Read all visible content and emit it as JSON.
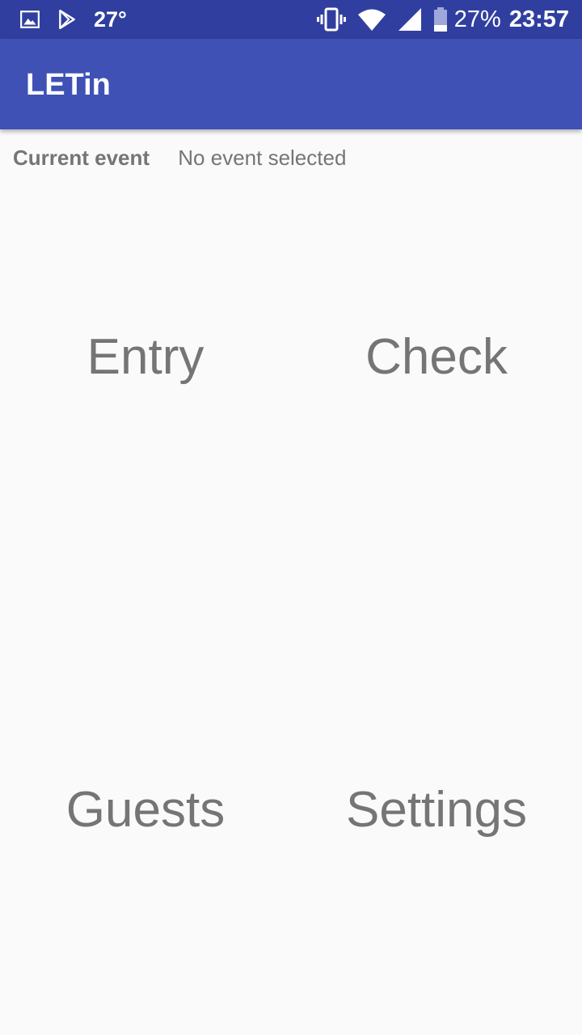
{
  "status_bar": {
    "temperature": "27°",
    "battery": "27%",
    "time": "23:57",
    "left_icons": [
      "image-icon",
      "play-store-icon"
    ],
    "right_icons": [
      "vibrate-icon",
      "wifi-icon",
      "signal-icon",
      "battery-icon"
    ]
  },
  "app_bar": {
    "title": "LETin",
    "color": "#3f51b5",
    "status_color": "#303f9f"
  },
  "current_event": {
    "label": "Current event",
    "value": "No event selected"
  },
  "menu": {
    "entry": "Entry",
    "check": "Check",
    "guests": "Guests",
    "settings": "Settings"
  }
}
